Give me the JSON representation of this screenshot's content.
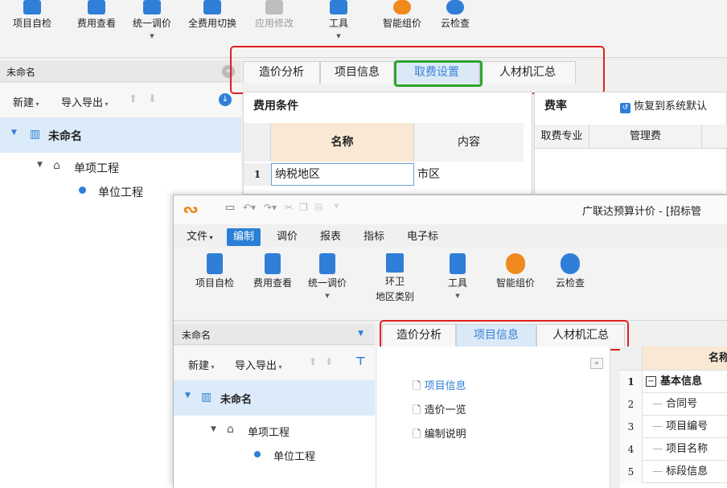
{
  "back_window": {
    "toolbar": [
      {
        "label": "项目自检",
        "icon": "checklist-icon",
        "color": "#2f7fd8"
      },
      {
        "label": "费用查看",
        "icon": "cost-view-icon",
        "color": "#2f7fd8"
      },
      {
        "label": "统一调价",
        "icon": "price-adjust-icon",
        "color": "#2f7fd8",
        "dropdown": true
      },
      {
        "label": "全费用切换",
        "icon": "switch-icon",
        "color": "#2f7fd8"
      },
      {
        "label": "应用修改",
        "icon": "apply-icon",
        "color": "#9a9a9a",
        "disabled": true
      },
      {
        "label": "工具",
        "icon": "tools-icon",
        "color": "#2f7fd8",
        "dropdown": true
      },
      {
        "label": "智能组价",
        "icon": "smart-price-icon",
        "color": "#f08a1e"
      },
      {
        "label": "云检查",
        "icon": "cloud-check-icon",
        "color": "#2f7fd8"
      }
    ],
    "sidebar": {
      "title": "未命名",
      "new_label": "新建",
      "import_export_label": "导入导出",
      "tree": {
        "root": "未命名",
        "child": "单项工程",
        "leaf": "单位工程"
      }
    },
    "tabs": [
      "造价分析",
      "项目信息",
      "取费设置",
      "人材机汇总"
    ],
    "active_tab": "取费设置",
    "fee_conditions": {
      "title": "费用条件",
      "headers": [
        "名称",
        "内容"
      ],
      "rows": [
        {
          "num": "1",
          "name": "纳税地区",
          "value": "市区"
        }
      ]
    },
    "rates": {
      "title": "费率",
      "restore_label": "恢复到系统默认",
      "headers": [
        "取费专业",
        "管理费"
      ]
    }
  },
  "front_window": {
    "app_title": "广联达预算计价 - [招标管",
    "menu": [
      "文件",
      "编制",
      "调价",
      "报表",
      "指标",
      "电子标"
    ],
    "active_menu": "编制",
    "toolbar": [
      {
        "label": "项目自检",
        "icon": "checklist-icon"
      },
      {
        "label": "费用查看",
        "icon": "cost-view-icon"
      },
      {
        "label": "统一调价",
        "icon": "price-adjust-icon",
        "dropdown": true
      },
      {
        "label": "环卫",
        "label2": "地区类别",
        "icon": "region-icon"
      },
      {
        "label": "工具",
        "icon": "tools-icon",
        "dropdown": true
      },
      {
        "label": "智能组价",
        "icon": "smart-price-icon"
      },
      {
        "label": "云检查",
        "icon": "cloud-check-icon"
      }
    ],
    "sidebar": {
      "title": "未命名",
      "new_label": "新建",
      "import_export_label": "导入导出",
      "tree": {
        "root": "未命名",
        "child": "单项工程",
        "leaf": "单位工程"
      }
    },
    "tabs": [
      "造价分析",
      "项目信息",
      "人材机汇总"
    ],
    "active_tab": "项目信息",
    "nav": [
      "项目信息",
      "造价一览",
      "编制说明"
    ],
    "grid": {
      "header": "名称",
      "rows": [
        {
          "num": "1",
          "name": "基本信息"
        },
        {
          "num": "2",
          "name": "合同号"
        },
        {
          "num": "3",
          "name": "项目编号"
        },
        {
          "num": "4",
          "name": "项目名称"
        },
        {
          "num": "5",
          "name": "标段信息"
        }
      ]
    }
  }
}
